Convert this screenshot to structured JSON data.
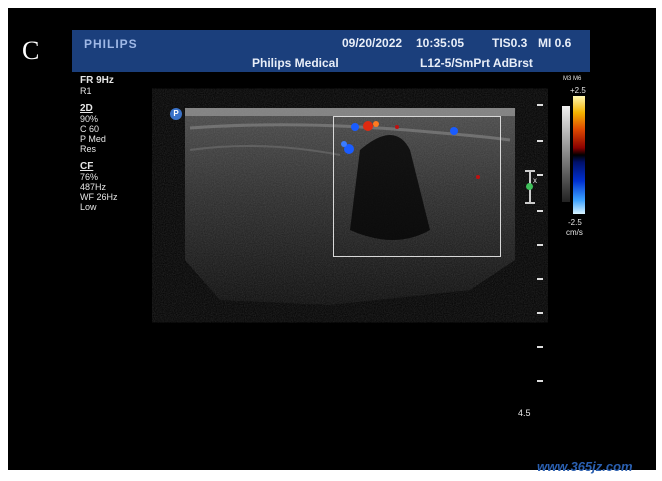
{
  "panel_letter": "C",
  "header": {
    "brand": "PHILIPS",
    "date": "09/20/2022",
    "time": "10:35:05",
    "tis": "TIS0.3",
    "mi": "MI 0.6",
    "institution": "Philips Medical",
    "probe_preset": "L12-5/SmPrt AdBrst"
  },
  "left_panel": {
    "fr": "FR 9Hz",
    "r": "R1",
    "mode2d_title": "2D",
    "mode2d_lines": [
      "90%",
      "C 60",
      "P Med",
      "Res"
    ],
    "cf_title": "CF",
    "cf_lines": [
      "76%",
      "487Hz",
      "WF  26Hz",
      "Low"
    ]
  },
  "color_scale": {
    "map": "M3 M6",
    "top": "+2.5",
    "bottom": "-2.5",
    "unit": "cm/s"
  },
  "depth_label": "4.5",
  "probe_marker": "P",
  "caliper_marker": "x",
  "watermark": "www.365jz.com",
  "colors": {
    "header_bg": "#1b3f7c",
    "doppler_red": "#e02a10",
    "doppler_blue": "#1a5cff"
  }
}
